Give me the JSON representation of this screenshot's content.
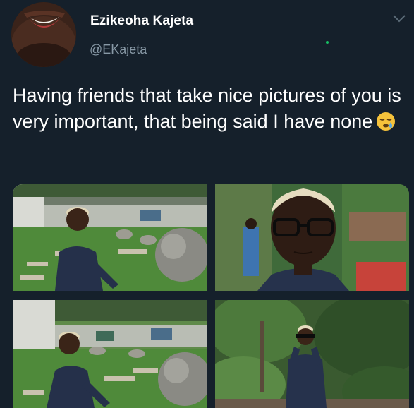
{
  "tweet": {
    "author_name": "Ezikeoha Kajeta",
    "author_handle": "@EKajeta",
    "text": "Having friends that take nice pictures of you is very important, that being said I have none",
    "emoji_icon": "sleepy-face-icon",
    "menu_icon": "chevron-down-icon"
  },
  "photos": [
    {
      "name": "photo-1"
    },
    {
      "name": "photo-2"
    },
    {
      "name": "photo-3"
    },
    {
      "name": "photo-4"
    }
  ],
  "colors": {
    "background": "#15202b",
    "text_primary": "#ffffff",
    "text_secondary": "#8899a6"
  }
}
